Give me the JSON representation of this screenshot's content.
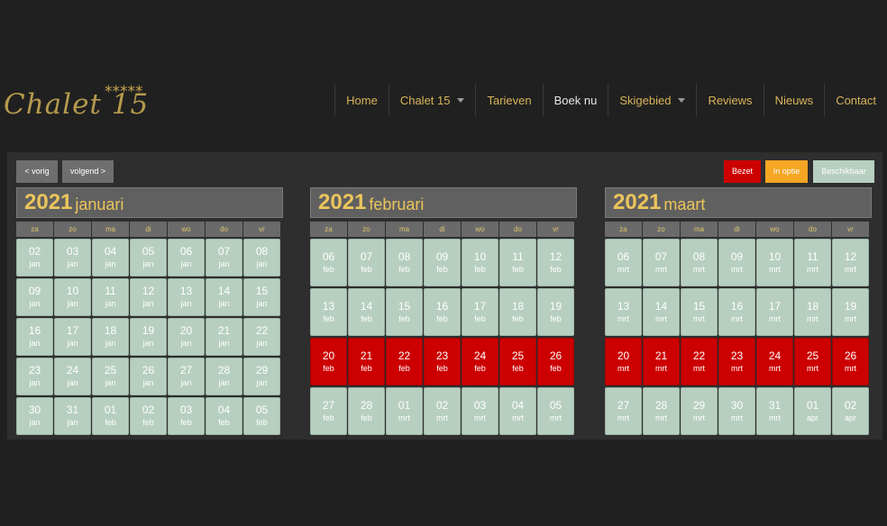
{
  "site": {
    "logo_text": "Chalet 15",
    "logo_stars": "*****"
  },
  "nav": [
    {
      "label": "Home",
      "name": "nav-home",
      "dropdown": false,
      "active": false
    },
    {
      "label": "Chalet 15",
      "name": "nav-chalet15",
      "dropdown": true,
      "active": false
    },
    {
      "label": "Tarieven",
      "name": "nav-tarieven",
      "dropdown": false,
      "active": false
    },
    {
      "label": "Boek nu",
      "name": "nav-boek-nu",
      "dropdown": false,
      "active": true
    },
    {
      "label": "Skigebied",
      "name": "nav-skigebied",
      "dropdown": true,
      "active": false
    },
    {
      "label": "Reviews",
      "name": "nav-reviews",
      "dropdown": false,
      "active": false
    },
    {
      "label": "Nieuws",
      "name": "nav-nieuws",
      "dropdown": false,
      "active": false
    },
    {
      "label": "Contact",
      "name": "nav-contact",
      "dropdown": false,
      "active": false
    }
  ],
  "controls": {
    "prev_label": "< vorig",
    "next_label": "volgend >"
  },
  "legend": {
    "busy_label": "Bezet",
    "option_label": "In optie",
    "available_label": "Beschikbaar"
  },
  "colors": {
    "available": "#b7cfc0",
    "busy": "#cc0000",
    "option": "#f5a623",
    "gold": "#ecc55c"
  },
  "weekdays": [
    "za",
    "zo",
    "ma",
    "di",
    "wo",
    "do",
    "vr"
  ],
  "months": [
    {
      "year": "2021",
      "name": "januari",
      "days": [
        [
          "02",
          "jan"
        ],
        [
          "03",
          "jan"
        ],
        [
          "04",
          "jan"
        ],
        [
          "05",
          "jan"
        ],
        [
          "06",
          "jan"
        ],
        [
          "07",
          "jan"
        ],
        [
          "08",
          "jan"
        ],
        [
          "09",
          "jan"
        ],
        [
          "10",
          "jan"
        ],
        [
          "11",
          "jan"
        ],
        [
          "12",
          "jan"
        ],
        [
          "13",
          "jan"
        ],
        [
          "14",
          "jan"
        ],
        [
          "15",
          "jan"
        ],
        [
          "16",
          "jan"
        ],
        [
          "17",
          "jan"
        ],
        [
          "18",
          "jan"
        ],
        [
          "19",
          "jan"
        ],
        [
          "20",
          "jan"
        ],
        [
          "21",
          "jan"
        ],
        [
          "22",
          "jan"
        ],
        [
          "23",
          "jan"
        ],
        [
          "24",
          "jan"
        ],
        [
          "25",
          "jan"
        ],
        [
          "26",
          "jan"
        ],
        [
          "27",
          "jan"
        ],
        [
          "28",
          "jan"
        ],
        [
          "29",
          "jan"
        ],
        [
          "30",
          "jan"
        ],
        [
          "31",
          "jan"
        ],
        [
          "01",
          "feb"
        ],
        [
          "02",
          "feb"
        ],
        [
          "03",
          "feb"
        ],
        [
          "04",
          "feb"
        ],
        [
          "05",
          "feb"
        ]
      ],
      "busy": []
    },
    {
      "year": "2021",
      "name": "februari",
      "days": [
        [
          "06",
          "feb"
        ],
        [
          "07",
          "feb"
        ],
        [
          "08",
          "feb"
        ],
        [
          "09",
          "feb"
        ],
        [
          "10",
          "feb"
        ],
        [
          "11",
          "feb"
        ],
        [
          "12",
          "feb"
        ],
        [
          "13",
          "feb"
        ],
        [
          "14",
          "feb"
        ],
        [
          "15",
          "feb"
        ],
        [
          "16",
          "feb"
        ],
        [
          "17",
          "feb"
        ],
        [
          "18",
          "feb"
        ],
        [
          "19",
          "feb"
        ],
        [
          "20",
          "feb"
        ],
        [
          "21",
          "feb"
        ],
        [
          "22",
          "feb"
        ],
        [
          "23",
          "feb"
        ],
        [
          "24",
          "feb"
        ],
        [
          "25",
          "feb"
        ],
        [
          "26",
          "feb"
        ],
        [
          "27",
          "feb"
        ],
        [
          "28",
          "feb"
        ],
        [
          "01",
          "mrt"
        ],
        [
          "02",
          "mrt"
        ],
        [
          "03",
          "mrt"
        ],
        [
          "04",
          "mrt"
        ],
        [
          "05",
          "mrt"
        ]
      ],
      "busy": [
        14,
        15,
        16,
        17,
        18,
        19,
        20
      ]
    },
    {
      "year": "2021",
      "name": "maart",
      "days": [
        [
          "06",
          "mrt"
        ],
        [
          "07",
          "mrt"
        ],
        [
          "08",
          "mrt"
        ],
        [
          "09",
          "mrt"
        ],
        [
          "10",
          "mrt"
        ],
        [
          "11",
          "mrt"
        ],
        [
          "12",
          "mrt"
        ],
        [
          "13",
          "mrt"
        ],
        [
          "14",
          "mrt"
        ],
        [
          "15",
          "mrt"
        ],
        [
          "16",
          "mrt"
        ],
        [
          "17",
          "mrt"
        ],
        [
          "18",
          "mrt"
        ],
        [
          "19",
          "mrt"
        ],
        [
          "20",
          "mrt"
        ],
        [
          "21",
          "mrt"
        ],
        [
          "22",
          "mrt"
        ],
        [
          "23",
          "mrt"
        ],
        [
          "24",
          "mrt"
        ],
        [
          "25",
          "mrt"
        ],
        [
          "26",
          "mrt"
        ],
        [
          "27",
          "mrt"
        ],
        [
          "28",
          "mrt"
        ],
        [
          "29",
          "mrt"
        ],
        [
          "30",
          "mrt"
        ],
        [
          "31",
          "mrt"
        ],
        [
          "01",
          "apr"
        ],
        [
          "02",
          "apr"
        ]
      ],
      "busy": [
        14,
        15,
        16,
        17,
        18,
        19,
        20
      ]
    }
  ]
}
